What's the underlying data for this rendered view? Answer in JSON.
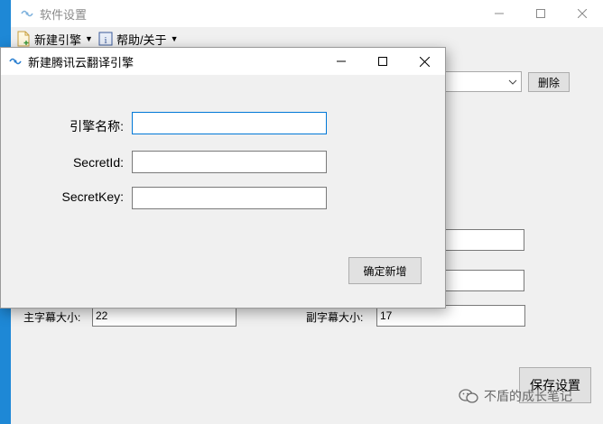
{
  "main": {
    "title": "软件设置",
    "toolbar": {
      "new_engine_label": "新建引擎",
      "help_label": "帮助/关于"
    },
    "delete_label": "删除",
    "subtitle_main_size_label": "主字幕大小:",
    "subtitle_main_size_value": "22",
    "subtitle_sub_size_label": "副字幕大小:",
    "subtitle_sub_size_value": "17",
    "save_label": "保存设置",
    "watermark_text": "不盾的成长笔记"
  },
  "dialog": {
    "title": "新建腾讯云翻译引擎",
    "engine_name_label": "引擎名称:",
    "engine_name_value": "",
    "secret_id_label": "SecretId:",
    "secret_id_value": "",
    "secret_key_label": "SecretKey:",
    "secret_key_value": "",
    "confirm_label": "确定新增"
  },
  "colors": {
    "accent": "#1e88d6",
    "focus_border": "#0078d7",
    "button_bg": "#e1e1e1"
  }
}
